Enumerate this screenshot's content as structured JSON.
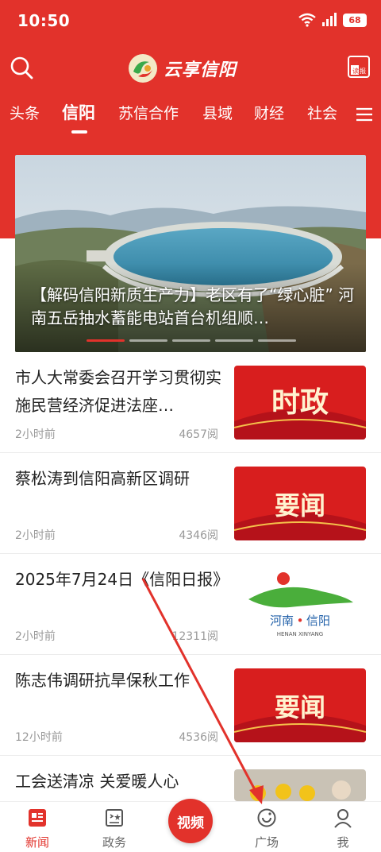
{
  "status_bar": {
    "time": "10:50",
    "battery": "68"
  },
  "header": {
    "app_title": "云享信阳",
    "read_icon_label": "读报"
  },
  "tabs": [
    {
      "label": "头条"
    },
    {
      "label": "信阳"
    },
    {
      "label": "苏信合作"
    },
    {
      "label": "县域"
    },
    {
      "label": "财经"
    },
    {
      "label": "社会"
    }
  ],
  "hero": {
    "title": "【解码信阳新质生产力】老区有了“绿心脏” 河南五岳抽水蓄能电站首台机组顺…"
  },
  "news": [
    {
      "title": "市人大常委会召开学习贯彻实施民营经济促进法座…",
      "time": "2小时前",
      "reads": "4657阅",
      "thumb_text": "时政"
    },
    {
      "title": "蔡松涛到信阳高新区调研",
      "time": "2小时前",
      "reads": "4346阅",
      "thumb_text": "要闻"
    },
    {
      "title": "2025年7月24日《信阳日报》",
      "time": "2小时前",
      "reads": "12311阅",
      "thumb_text": "河南",
      "thumb_text2": "信阳",
      "thumb_sub": "HENAN XINYANG"
    },
    {
      "title": "陈志伟调研抗旱保秋工作",
      "time": "12小时前",
      "reads": "4536阅",
      "thumb_text": "要闻"
    },
    {
      "title": "工会送清凉 关爱暖人心",
      "time": "",
      "reads": ""
    }
  ],
  "bottom_nav": {
    "news": "新闻",
    "gov": "政务",
    "video": "视频",
    "square": "广场",
    "me": "我"
  },
  "colors": {
    "brand": "#e2322b",
    "text": "#222222",
    "muted": "#999999"
  }
}
